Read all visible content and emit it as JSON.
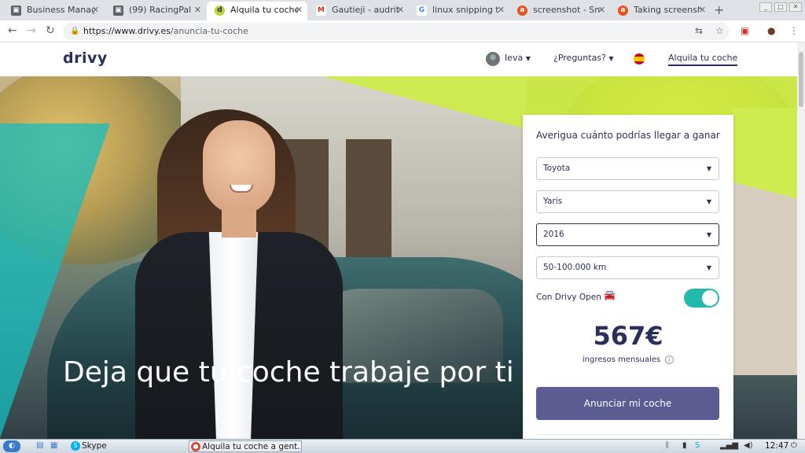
{
  "browser": {
    "tabs": [
      {
        "label": "Business Manag",
        "icon": "page-icon",
        "color": "#5f6368"
      },
      {
        "label": "(99) RacingPal",
        "icon": "page-icon",
        "color": "#5f6368"
      },
      {
        "label": "Alquila tu coche",
        "icon": "drivy-icon",
        "color": "#b5d335",
        "active": true
      },
      {
        "label": "Gautieji - audrit",
        "icon": "gmail-icon",
        "color": "#d93025"
      },
      {
        "label": "linux snipping t",
        "icon": "google-icon",
        "color": "#4285f4"
      },
      {
        "label": "screenshot - Sn",
        "icon": "ask-icon",
        "color": "#e8541f"
      },
      {
        "label": "Taking screensh",
        "icon": "ask-icon",
        "color": "#e8541f"
      }
    ],
    "new_tab": "+",
    "url_host": "https://www.drivy.es",
    "url_path": "/anuncia-tu-coche"
  },
  "site": {
    "logo": "drivy",
    "user_name": "Ieva",
    "faq_label": "¿Preguntas?",
    "rent_link": "Alquila tu coche"
  },
  "hero": {
    "title": "Deja que tu coche trabaje por ti"
  },
  "estimator": {
    "title": "Averigua cuánto podrías llegar a ganar",
    "brand": "Toyota",
    "model": "Yaris",
    "year": "2016",
    "mileage": "50-100.000 km",
    "open_label": "Con Drivy Open",
    "open_enabled": true,
    "amount": "567€",
    "amount_caption": "ingresos mensuales",
    "button_label": "Anunciar mi coche"
  },
  "taskbar": {
    "skype_label": "Skype",
    "chrome_label": "Alquila tu coche a gent...",
    "clock": "12:47"
  },
  "colors": {
    "brand_navy": "#2b2f5b",
    "toggle_teal": "#23b9ad",
    "cta_purple": "#5a5c92"
  }
}
